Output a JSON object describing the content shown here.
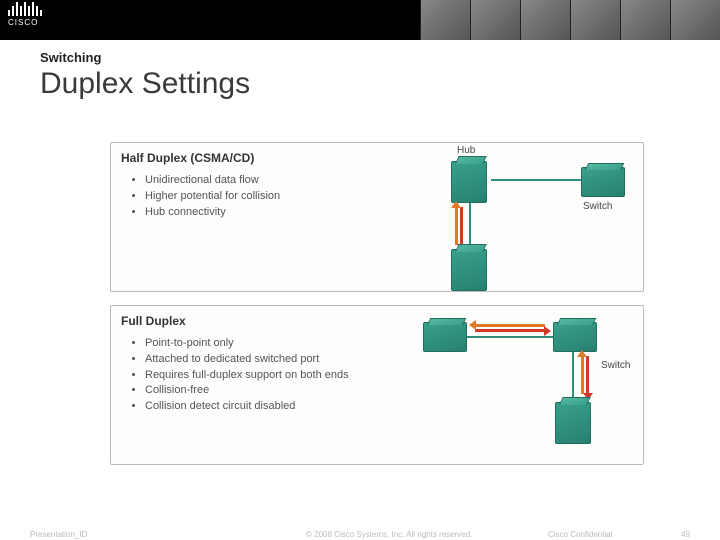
{
  "brand_text": "CISCO",
  "header": {
    "kicker": "Switching",
    "title": "Duplex Settings"
  },
  "panel1": {
    "title": "Half Duplex (CSMA/CD)",
    "bullets": [
      "Unidirectional data flow",
      "Higher potential for collision",
      "Hub connectivity"
    ],
    "labels": {
      "hub": "Hub",
      "switch": "Switch"
    }
  },
  "panel2": {
    "title": "Full Duplex",
    "bullets": [
      "Point-to-point only",
      "Attached to dedicated switched port",
      "Requires full-duplex support on both ends",
      "Collision-free",
      "Collision detect circuit disabled"
    ],
    "labels": {
      "switch": "Switch"
    }
  },
  "footer": {
    "left": "Presentation_ID",
    "center": "© 2008 Cisco Systems, Inc. All rights reserved.",
    "right": "Cisco Confidential",
    "page": "49"
  }
}
